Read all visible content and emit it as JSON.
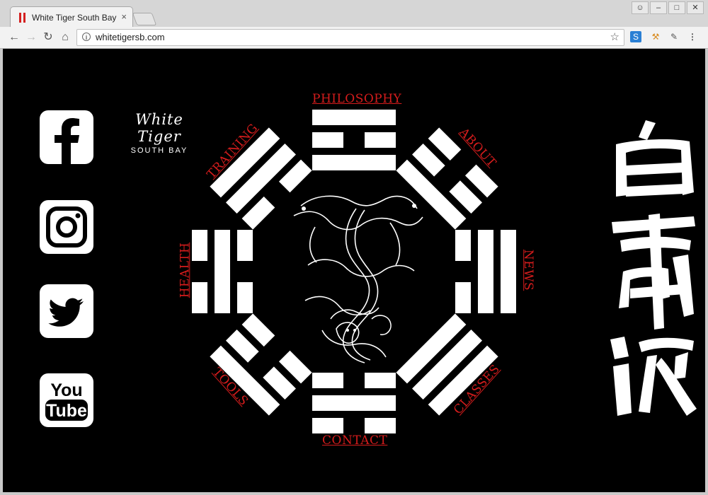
{
  "browser": {
    "tab_title": "White Tiger South Bay",
    "tab_close": "×",
    "url": "whitetigersb.com",
    "back": "←",
    "forward": "→",
    "reload": "↻",
    "home": "⌂"
  },
  "social": [
    {
      "name": "facebook",
      "icon": "facebook-icon"
    },
    {
      "name": "instagram",
      "icon": "instagram-icon"
    },
    {
      "name": "twitter",
      "icon": "twitter-icon"
    },
    {
      "name": "youtube",
      "icon": "youtube-icon",
      "text_top": "You",
      "text_bottom": "Tube"
    }
  ],
  "brand": {
    "name": "White Tiger",
    "sub": "SOUTH BAY"
  },
  "nav": {
    "philosophy": "PHILOSOPHY",
    "about": "ABOUT",
    "news": "NEWS",
    "classes": "CLASSES",
    "contact": "CONTACT",
    "tools": "TOOLS",
    "health": "HEALTH",
    "training": "TRAINING"
  },
  "colors": {
    "background": "#000000",
    "link": "#d41c1c",
    "trigram": "#ffffff"
  }
}
